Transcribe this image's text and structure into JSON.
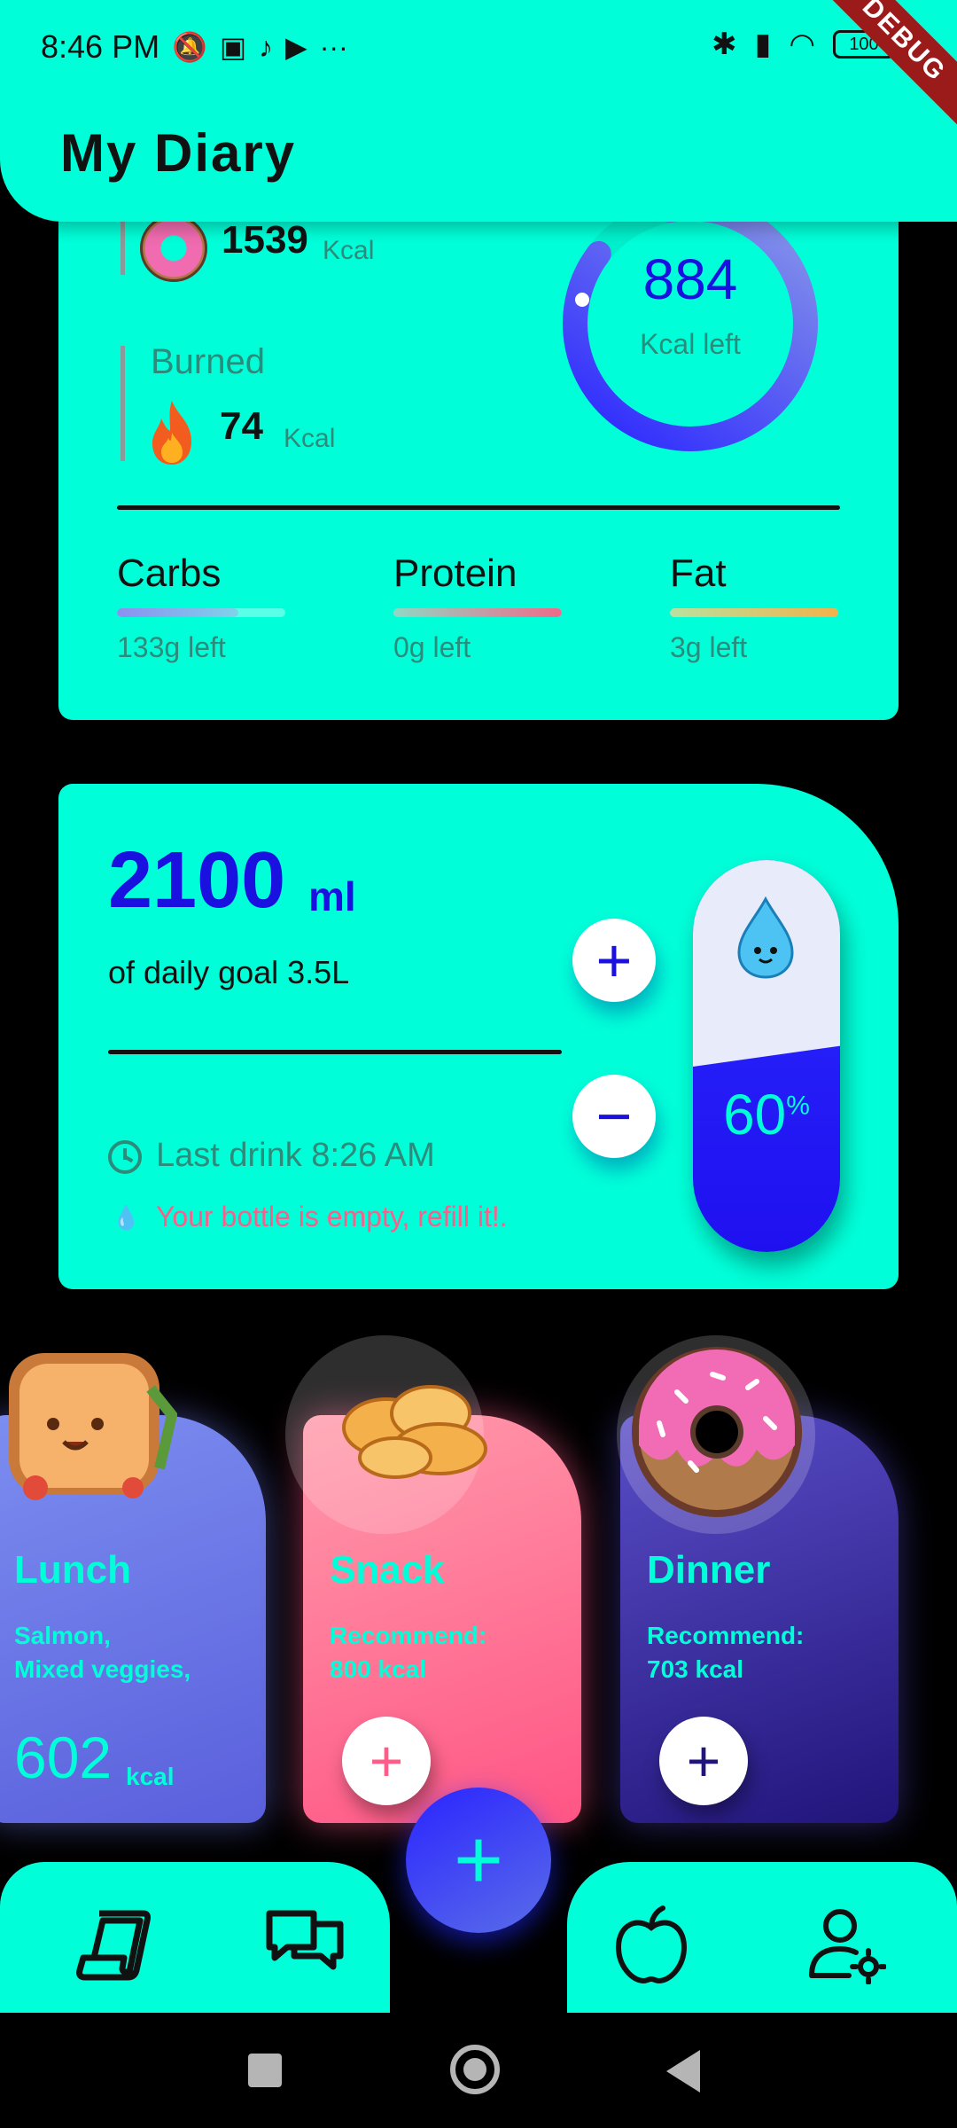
{
  "status_bar": {
    "time": "8:46 PM",
    "more": "···",
    "battery": "100",
    "debug_banner": "DEBUG",
    "icons": [
      "mute-bell-icon",
      "media-icon",
      "tiktok-icon",
      "youtube-icon",
      "bluetooth-icon",
      "signal-icon",
      "wifi-icon",
      "battery-icon"
    ]
  },
  "header": {
    "title": "My Diary"
  },
  "calories": {
    "eaten_value": "1539",
    "eaten_unit": "Kcal",
    "burned_label": "Burned",
    "burned_value": "74",
    "burned_unit": "Kcal",
    "ring_value": "884",
    "ring_label": "Kcal left",
    "macros": [
      {
        "name": "Carbs",
        "left": "133g left",
        "fill_fraction": 0.72,
        "color_start": "#8a90f0",
        "color_end": "#7fd3ea"
      },
      {
        "name": "Protein",
        "left": "0g left",
        "fill_fraction": 1.0,
        "color_start": "#8fd8c4",
        "color_end": "#f06a8a"
      },
      {
        "name": "Fat",
        "left": "3g left",
        "fill_fraction": 1.0,
        "color_start": "#b8e2a0",
        "color_end": "#f2b24a"
      }
    ]
  },
  "water": {
    "value": "2100",
    "unit": "ml",
    "goal_text": "of daily goal 3.5L",
    "last_drink": "Last drink 8:26 AM",
    "refill_text": "Your bottle is empty, refill it!.",
    "percent": "60",
    "percent_sign": "%",
    "fill_fraction": 0.6,
    "plus_label": "+",
    "minus_label": "−"
  },
  "meals": [
    {
      "name": "Lunch",
      "desc": [
        "Salmon,",
        "Mixed veggies,"
      ],
      "kcal": "602",
      "kcal_unit": "kcal"
    },
    {
      "name": "Snack",
      "desc": [
        "Recommend:",
        "800 kcal"
      ],
      "add_label": "+"
    },
    {
      "name": "Dinner",
      "desc": [
        "Recommend:",
        "703 kcal"
      ],
      "add_label": "+"
    }
  ],
  "fab": {
    "label": "+"
  },
  "nav": {
    "items": [
      "diary-scroll-icon",
      "chat-icon",
      "apple-icon",
      "user-settings-icon"
    ]
  },
  "colors": {
    "accent": "#00FFD9",
    "primary_blue": "#1A10E0",
    "alert_pink": "#FF5C8A",
    "muted_teal": "#2C8B7A"
  }
}
